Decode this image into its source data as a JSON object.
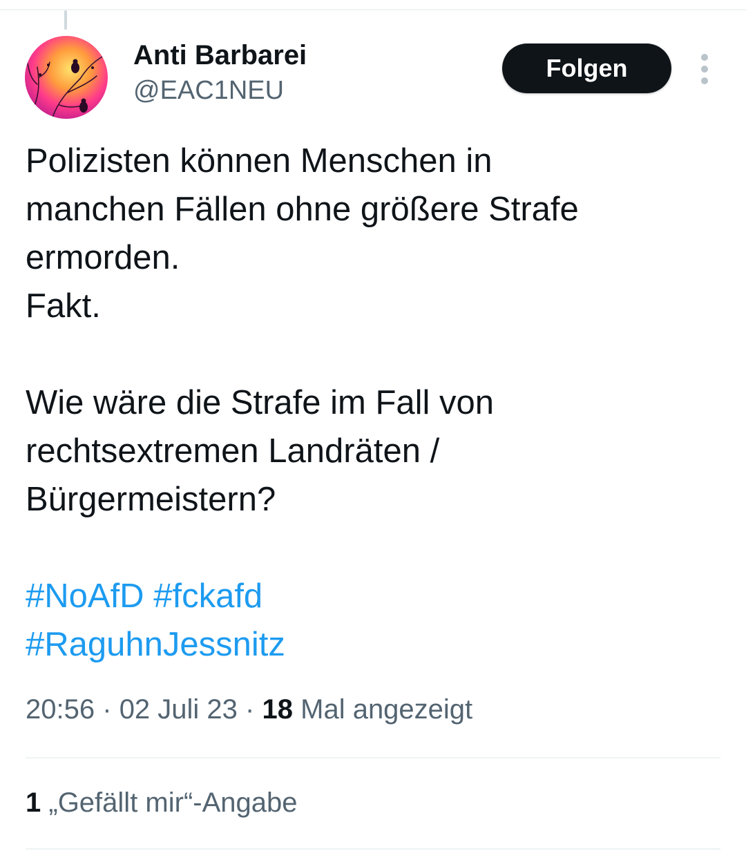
{
  "tweet": {
    "author": {
      "display_name": "Anti Barbarei",
      "handle": "@EAC1NEU",
      "avatar_icon": "avatar-birds-on-branch-icon"
    },
    "follow_label": "Folgen",
    "more_icon": "more-vertical-icon",
    "text_lines": [
      "Polizisten können Menschen in",
      "manchen Fällen ohne größere Strafe",
      "ermorden.",
      "Fakt.",
      "",
      "Wie wäre die Strafe im Fall von",
      "rechtsextremen Landräten /",
      "Bürgermeistern?",
      ""
    ],
    "hashtags": [
      "#NoAfD",
      "#fckafd",
      "#RaguhnJessnitz"
    ],
    "time": "20:56",
    "date": "02 Juli 23",
    "separator": "·",
    "views_count": "18",
    "views_label": "Mal angezeigt",
    "likes_count": "1",
    "likes_label": "„Gefällt mir“-Angabe"
  },
  "colors": {
    "text": "#0f1419",
    "secondary": "#536471",
    "hashtag": "#1d9bf0",
    "follow_bg": "#0f1419",
    "divider": "#eff3f4"
  }
}
